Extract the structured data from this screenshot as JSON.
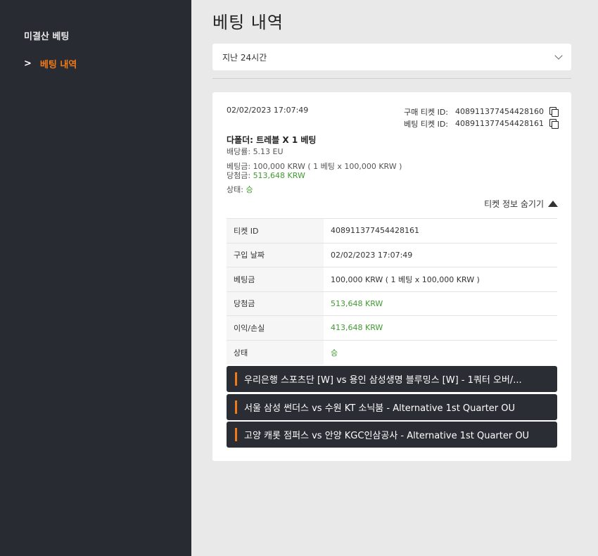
{
  "sidebar": {
    "title": "미결산 베팅",
    "items": [
      {
        "label": "베팅 내역",
        "active": true
      }
    ]
  },
  "main": {
    "title": "베팅 내역",
    "filter": {
      "selected": "지난 24시간"
    }
  },
  "ticket": {
    "date": "02/02/2023 17:07:49",
    "purchase_label": "구매 티켓 ID:",
    "purchase_id": "408911377454428160",
    "bet_label": "베팅 티켓 ID:",
    "bet_id": "408911377454428161",
    "bet_type": "다폴더: 트레블 X 1 베팅",
    "odds_label": "배당률: ",
    "odds": "5.13 EU",
    "stake_label": "베팅금: ",
    "stake": "100,000 KRW ( 1 베팅 x 100,000 KRW )",
    "payout_label": "당첨금: ",
    "payout": "513,648 KRW",
    "status_label": "상태: ",
    "status": "승",
    "toggle_label": "티켓 정보 숨기기",
    "details": [
      {
        "key": "티켓 ID",
        "value": "408911377454428161"
      },
      {
        "key": "구입 날짜",
        "value": "02/02/2023 17:07:49"
      },
      {
        "key": "베팅금",
        "value": "100,000 KRW ( 1 베팅 x 100,000 KRW )"
      },
      {
        "key": "당첨금",
        "value": "513,648 KRW"
      },
      {
        "key": "이익/손실",
        "value": "413,648 KRW"
      },
      {
        "key": "상태",
        "value": "승"
      }
    ],
    "events": [
      "우리은행 스포츠단 [W] vs 용인 삼성생명 블루밍스 [W] - 1쿼터 오버/...",
      "서울 삼성 썬더스 vs 수원 KT 소닉붐 - Alternative 1st Quarter OU",
      "고양 캐롯 점퍼스 vs 안양 KGC인삼공사 - Alternative 1st Quarter OU"
    ]
  },
  "colors": {
    "sidebar_bg": "#292b33",
    "accent": "#f07a1a",
    "win_green": "#3f9b2f",
    "page_bg": "#e9e9ea"
  }
}
